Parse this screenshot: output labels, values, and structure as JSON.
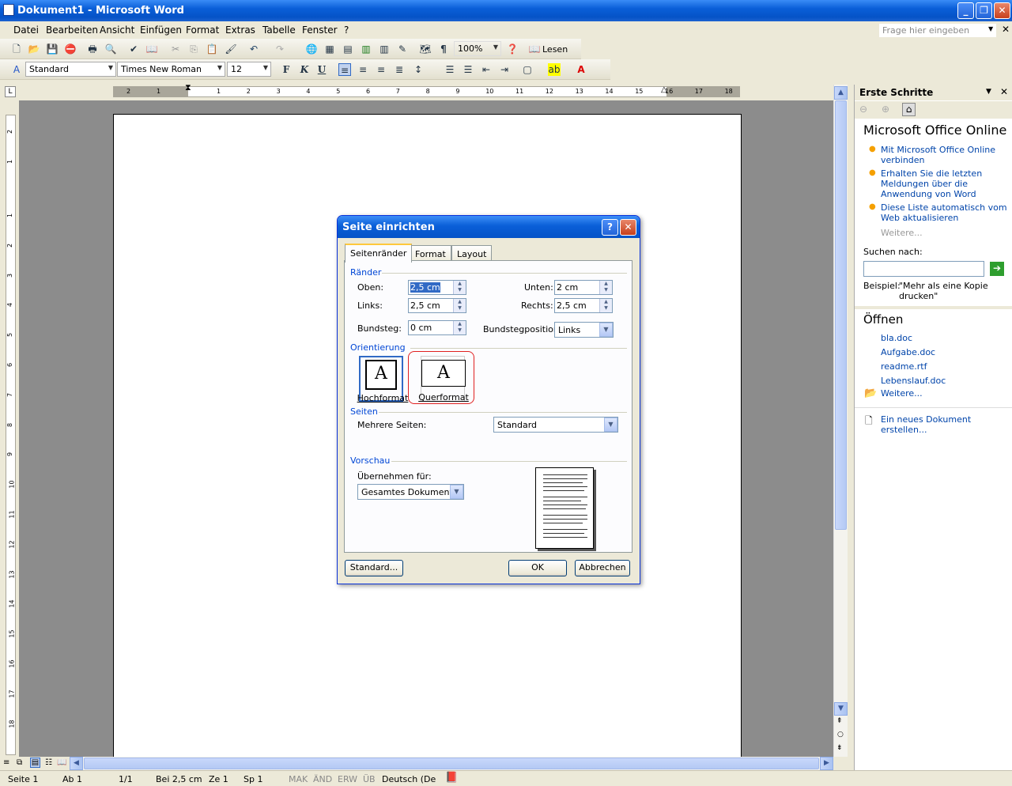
{
  "window": {
    "title": "Dokument1 - Microsoft Word"
  },
  "menubar": {
    "items": [
      "Datei",
      "Bearbeiten",
      "Ansicht",
      "Einfügen",
      "Format",
      "Extras",
      "Tabelle",
      "Fenster",
      "?"
    ],
    "ask_placeholder": "Frage hier eingeben"
  },
  "toolbar": {
    "zoom": "100%",
    "read_label": "Lesen",
    "style": "Standard",
    "font": "Times New Roman",
    "size": "12",
    "bold": "F",
    "italic": "K",
    "underline": "U"
  },
  "taskpane": {
    "title": "Erste Schritte",
    "office_title": "Microsoft Office Online",
    "links": [
      "Mit Microsoft Office Online verbinden",
      "Erhalten Sie die letzten Meldungen über die Anwendung von Word",
      "Diese Liste automatisch vom Web aktualisieren"
    ],
    "more": "Weitere...",
    "search_label": "Suchen nach:",
    "example_label": "Beispiel:",
    "example_text": "\"Mehr als eine Kopie drucken\"",
    "open_title": "Öffnen",
    "files": [
      "bla.doc",
      "Aufgabe.doc",
      "readme.rtf",
      "Lebenslauf.doc"
    ],
    "open_more": "Weitere...",
    "new_doc": "Ein neues Dokument erstellen..."
  },
  "statusbar": {
    "page": "Seite 1",
    "section": "Ab 1",
    "pages": "1/1",
    "at": "Bei 2,5 cm",
    "line": "Ze 1",
    "col": "Sp 1",
    "mak": "MAK",
    "aend": "ÄND",
    "erw": "ERW",
    "ueb": "ÜB",
    "lang": "Deutsch (De"
  },
  "dialog": {
    "title": "Seite einrichten",
    "tabs": [
      "Seitenränder",
      "Format",
      "Layout"
    ],
    "active_tab": "Seitenränder",
    "margins_section": "Ränder",
    "top_label": "Oben:",
    "top_value": "2,5 cm",
    "bottom_label": "Unten:",
    "bottom_value": "2 cm",
    "left_label": "Links:",
    "left_value": "2,5 cm",
    "right_label": "Rechts:",
    "right_value": "2,5 cm",
    "gutter_label": "Bundsteg:",
    "gutter_value": "0 cm",
    "gutter_pos_label": "Bundstegposition:",
    "gutter_pos_value": "Links",
    "orientation_section": "Orientierung",
    "portrait": "Hochformat",
    "landscape": "Querformat",
    "orientation_glyph": "A",
    "pages_section": "Seiten",
    "multiple_pages_label": "Mehrere Seiten:",
    "multiple_pages_value": "Standard",
    "preview_section": "Vorschau",
    "apply_label": "Übernehmen für:",
    "apply_value": "Gesamtes Dokument",
    "default_button": "Standard...",
    "ok_button": "OK",
    "cancel_button": "Abbrechen"
  },
  "ruler": {
    "h_ticks": [
      "2",
      "1",
      "1",
      "2",
      "3",
      "4",
      "5",
      "6",
      "7",
      "8",
      "9",
      "10",
      "11",
      "12",
      "13",
      "14",
      "15",
      "16",
      "17",
      "18"
    ],
    "v_ticks": [
      "2",
      "1",
      "1",
      "2",
      "3",
      "4",
      "5",
      "6",
      "7",
      "8",
      "9",
      "10",
      "11",
      "12",
      "13",
      "14",
      "15",
      "16",
      "17",
      "18"
    ]
  },
  "colors": {
    "titlebar": "#0a5fd8",
    "link": "#0044aa",
    "section": "#0046d5",
    "highlight_ring": "#e02020"
  }
}
